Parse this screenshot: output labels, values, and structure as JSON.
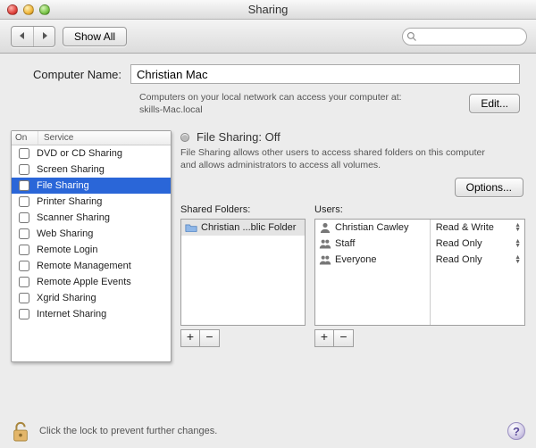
{
  "window": {
    "title": "Sharing"
  },
  "toolbar": {
    "back_tip": "Back",
    "forward_tip": "Forward",
    "show_all": "Show All",
    "search_placeholder": ""
  },
  "computer_name": {
    "label": "Computer Name:",
    "value": "Christian Mac",
    "hint_line1": "Computers on your local network can access your computer at:",
    "hint_line2": "skills-Mac.local",
    "edit_label": "Edit..."
  },
  "services": {
    "header_on": "On",
    "header_service": "Service",
    "items": [
      {
        "label": "DVD or CD Sharing",
        "on": false,
        "selected": false
      },
      {
        "label": "Screen Sharing",
        "on": false,
        "selected": false
      },
      {
        "label": "File Sharing",
        "on": false,
        "selected": true
      },
      {
        "label": "Printer Sharing",
        "on": false,
        "selected": false
      },
      {
        "label": "Scanner Sharing",
        "on": false,
        "selected": false
      },
      {
        "label": "Web Sharing",
        "on": false,
        "selected": false
      },
      {
        "label": "Remote Login",
        "on": false,
        "selected": false
      },
      {
        "label": "Remote Management",
        "on": false,
        "selected": false
      },
      {
        "label": "Remote Apple Events",
        "on": false,
        "selected": false
      },
      {
        "label": "Xgrid Sharing",
        "on": false,
        "selected": false
      },
      {
        "label": "Internet Sharing",
        "on": false,
        "selected": false
      }
    ]
  },
  "detail": {
    "status_title": "File Sharing: Off",
    "status_desc": "File Sharing allows other users to access shared folders on this computer and allows administrators to access all volumes.",
    "options_label": "Options..."
  },
  "shared_folders": {
    "label": "Shared Folders:",
    "items": [
      {
        "label": "Christian ...blic Folder",
        "selected": true
      }
    ]
  },
  "users": {
    "label": "Users:",
    "items": [
      {
        "icon": "person",
        "label": "Christian Cawley",
        "perm": "Read & Write"
      },
      {
        "icon": "group",
        "label": "Staff",
        "perm": "Read Only"
      },
      {
        "icon": "group",
        "label": "Everyone",
        "perm": "Read Only"
      }
    ]
  },
  "buttons": {
    "plus": "+",
    "minus": "−"
  },
  "lock_text": "Click the lock to prevent further changes.",
  "help": "?"
}
